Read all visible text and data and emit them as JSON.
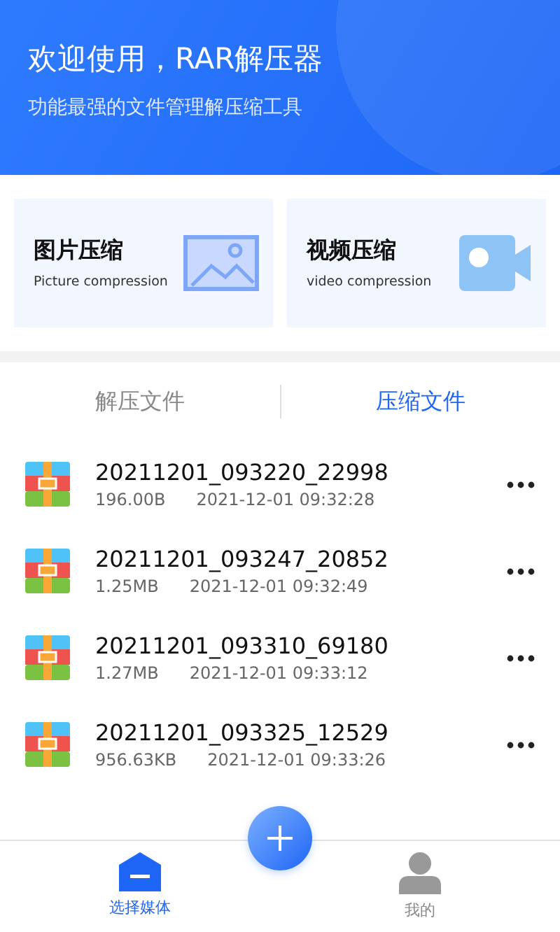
{
  "header": {
    "title": "欢迎使用，RAR解压器",
    "subtitle": "功能最强的文件管理解压缩工具"
  },
  "cards": [
    {
      "kind": "image",
      "title": "图片压缩",
      "subtitle": "Picture compression"
    },
    {
      "kind": "video",
      "title": "视频压缩",
      "subtitle": "video compression"
    }
  ],
  "tabs": [
    {
      "label": "解压文件",
      "selected": false
    },
    {
      "label": "压缩文件",
      "selected": true
    }
  ],
  "files": [
    {
      "name": "20211201_093220_22998",
      "size": "196.00B",
      "date": "2021-12-01 09:32:28"
    },
    {
      "name": "20211201_093247_20852",
      "size": "1.25MB",
      "date": "2021-12-01 09:32:49"
    },
    {
      "name": "20211201_093310_69180",
      "size": "1.27MB",
      "date": "2021-12-01 09:33:12"
    },
    {
      "name": "20211201_093325_12529",
      "size": "956.63KB",
      "date": "2021-12-01 09:33:26"
    }
  ],
  "bottom_nav": [
    {
      "kind": "home",
      "label": "选择媒体",
      "selected": true
    },
    {
      "kind": "person",
      "label": "我的",
      "selected": false
    }
  ]
}
